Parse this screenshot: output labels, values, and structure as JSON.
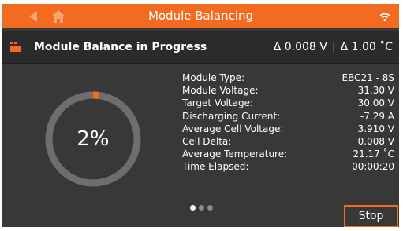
{
  "titlebar": {
    "title": "Module Balancing",
    "back_icon": "back-arrow-icon",
    "home_icon": "home-icon",
    "wifi_icon": "wifi-icon",
    "background_color": "#f36a21"
  },
  "subheader": {
    "icon": "battery-module-icon",
    "title": "Module Balance in Progress",
    "delta_voltage": "Δ 0.008 V",
    "separator": "|",
    "delta_temperature": "Δ 1.00 ˚C"
  },
  "gauge": {
    "progress_percent": 2,
    "label": "2%",
    "track_color": "#6e6e6e",
    "fill_color": "#f36a21"
  },
  "details": [
    {
      "label": "Module Type:",
      "value": "EBC21 - 8S"
    },
    {
      "label": "Module Voltage:",
      "value": "31.30 V"
    },
    {
      "label": "Target Voltage:",
      "value": "30.00 V"
    },
    {
      "label": "Discharging Current:",
      "value": "-7.29 A"
    },
    {
      "label": "Average Cell Voltage:",
      "value": "3.910 V"
    },
    {
      "label": "Cell Delta:",
      "value": "0.008 V"
    },
    {
      "label": "Average Temperature:",
      "value": "21.17 ˚C"
    },
    {
      "label": "Time Elapsed:",
      "value": "00:00:20"
    }
  ],
  "pagination": {
    "page_count": 3,
    "active_index": 0
  },
  "actions": {
    "stop_label": "Stop"
  }
}
